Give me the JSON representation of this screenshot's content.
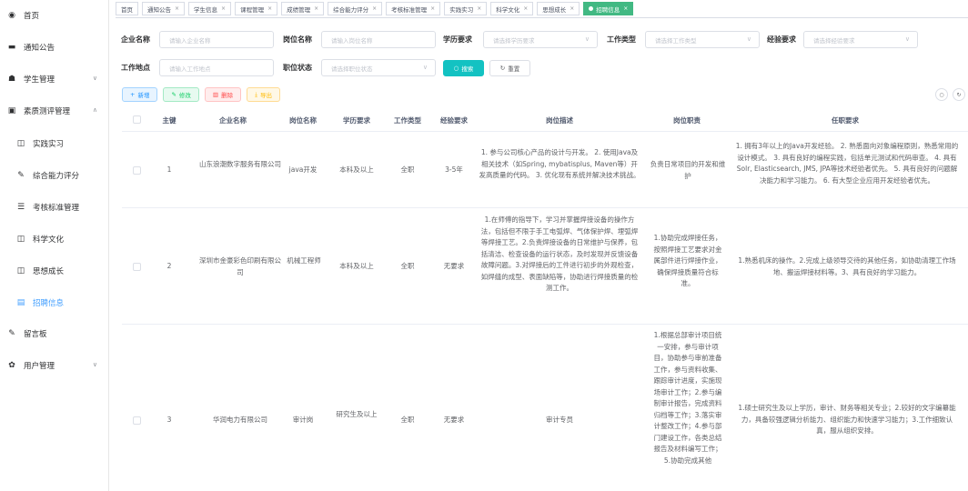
{
  "sidebar": {
    "items": [
      {
        "label": "首页",
        "icon": "dashboard-icon",
        "arrow": ""
      },
      {
        "label": "通知公告",
        "icon": "message-icon",
        "arrow": ""
      },
      {
        "label": "学生管理",
        "icon": "user-icon",
        "arrow": "∨"
      },
      {
        "label": "素质测评管理",
        "icon": "document-icon",
        "arrow": "∧"
      },
      {
        "label": "实践实习",
        "icon": "book-icon",
        "arrow": ""
      },
      {
        "label": "综合能力评分",
        "icon": "edit-icon",
        "arrow": ""
      },
      {
        "label": "考核标准管理",
        "icon": "list-icon",
        "arrow": ""
      },
      {
        "label": "科学文化",
        "icon": "book-icon",
        "arrow": ""
      },
      {
        "label": "思想成长",
        "icon": "book-icon",
        "arrow": ""
      },
      {
        "label": "招聘信息",
        "icon": "doc-icon",
        "arrow": ""
      },
      {
        "label": "留言板",
        "icon": "edit-icon",
        "arrow": ""
      },
      {
        "label": "用户管理",
        "icon": "gear-icon",
        "arrow": "∨"
      }
    ]
  },
  "tabs": [
    {
      "label": "首页",
      "closable": false
    },
    {
      "label": "通知公告",
      "closable": true
    },
    {
      "label": "学生信息",
      "closable": true
    },
    {
      "label": "课程管理",
      "closable": true
    },
    {
      "label": "成绩管理",
      "closable": true
    },
    {
      "label": "综合能力评分",
      "closable": true
    },
    {
      "label": "考核标准管理",
      "closable": true
    },
    {
      "label": "实践实习",
      "closable": true
    },
    {
      "label": "科学文化",
      "closable": true
    },
    {
      "label": "思想成长",
      "closable": true
    },
    {
      "label": "招聘信息",
      "closable": true
    }
  ],
  "tab_close": "×",
  "search": {
    "company_label": "企业名称",
    "company_placeholder": "请输入企业名称",
    "position_label": "岗位名称",
    "position_placeholder": "请输入岗位名称",
    "education_label": "学历要求",
    "education_placeholder": "请选择学历要求",
    "jobtype_label": "工作类型",
    "jobtype_placeholder": "请选择工作类型",
    "experience_label": "经验要求",
    "experience_placeholder": "请选择经验要求",
    "location_label": "工作地点",
    "location_placeholder": "请输入工作地点",
    "status_label": "职位状态",
    "status_placeholder": "请选择职位状态",
    "search_button": "搜索",
    "reset_button": "重置",
    "chevron": "∨"
  },
  "toolbar": {
    "add": "新增",
    "edit": "修改",
    "delete": "删除",
    "export": "导出"
  },
  "table": {
    "headers": {
      "id": "主键",
      "company": "企业名称",
      "position": "岗位名称",
      "education": "学历要求",
      "jobtype": "工作类型",
      "experience": "经验要求",
      "description": "岗位描述",
      "duty": "岗位职责",
      "requirement": "任职要求"
    },
    "rows": [
      {
        "id": "1",
        "company": "山东浪潮数字服务有限公司",
        "position": "java开发",
        "education": "本科及以上",
        "jobtype": "全职",
        "experience": "3-5年",
        "description": "1. 参与公司核心产品的设计与开发。 2. 使用Java及相关技术（如Spring, mybatisplus, Maven等）开发高质量的代码。 3. 优化现有系统并解决技术挑战。",
        "duty": "负责日常项目的开发和维护",
        "requirement": "1. 拥有3年以上的Java开发经验。 2. 熟悉面向对象编程原则，熟悉常用的设计模式。 3. 具有良好的编程实践，包括单元测试和代码审查。 4. 具有Solr, Elasticsearch, JMS, JPA等技术经验者优先。 5. 具有良好的问题解决能力和学习能力。 6. 有大型企业应用开发经验者优先。"
      },
      {
        "id": "2",
        "company": "深圳市金豪彩色印刷有限公司",
        "position": "机械工程师",
        "education": "本科及以上",
        "jobtype": "全职",
        "experience": "无要求",
        "description": "1.在师傅的指导下，学习并掌握焊接设备的操作方法，包括但不限于手工电弧焊、气体保护焊、埋弧焊等焊接工艺。2.负责焊接设备的日常维护与保养，包括清洁、检查设备的运行状态，及时发现并反馈设备故障问题。3.对焊接后的工件进行初步的外观检查，如焊缝的成型、表面缺陷等，协助进行焊接质量的检测工作。",
        "duty": "1.协助完成焊接任务，按照焊接工艺要求对金属部件进行焊接作业，确保焊接质量符合标准。",
        "requirement": "1.熟悉机床的操作。2.完成上级领导交待的其他任务，如协助清理工作场地、搬运焊接材料等。3、具有良好的学习能力。"
      },
      {
        "id": "3",
        "company": "华润电力有限公司",
        "position": "审计岗",
        "education": "研究生及以上",
        "jobtype": "全职",
        "experience": "无要求",
        "description": "审计专员",
        "duty": "1.根据总部审计项目统一安排，参与审计项目，协助参与审前准备工作，参与资料收集、跟踪审计进度，实施现场审计工作；2.参与编制审计报告，完成资料归档等工作；3.落实审计整改工作；4.参与部门建设工作，各类总结报告及材料编写工作；5.协助完成其他",
        "requirement": "1.硕士研究生及以上学历，审计、财务等相关专业；2.较好的文字编纂能力，具备较强逻辑分析能力、组织能力和快速学习能力；3.工作细致认真，服从组织安排。"
      }
    ]
  },
  "colors": {
    "accent": "#409eff",
    "active_tab": "#42b983",
    "search_button": "#13c2c2"
  }
}
